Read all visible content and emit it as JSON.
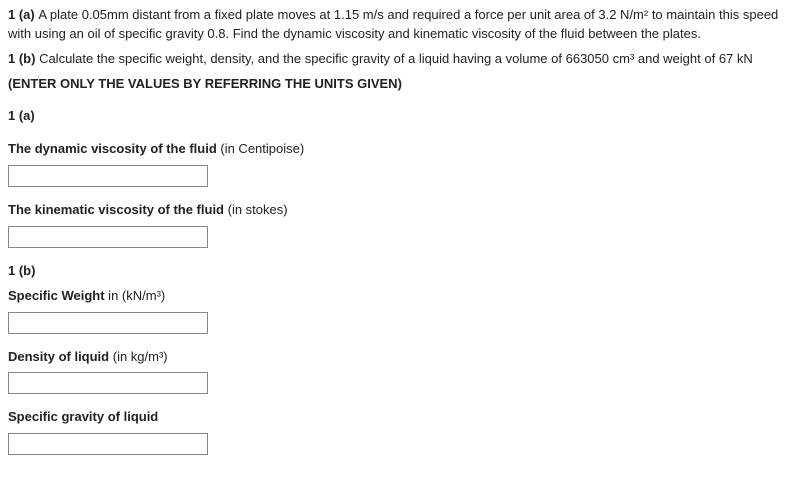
{
  "problem_1a_prefix": "1 (a) ",
  "problem_1a_text": "A plate 0.05mm distant from a fixed plate moves at 1.15 m/s and required a force per unit area of 3.2 N/m² to maintain this speed with using an oil of specific gravity 0.8. Find the dynamic viscosity and kinematic viscosity of the fluid between the plates.",
  "problem_1b_prefix": "1 (b)  ",
  "problem_1b_text": "Calculate the specific weight, density, and the specific gravity of a liquid having a volume of 663050 cm³ and weight of 67 kN",
  "instruction": "(ENTER ONLY THE VALUES BY REFERRING THE UNITS GIVEN)",
  "section_1a": "1 (a)",
  "section_1b": "1 (b)",
  "fields": {
    "dyn_visc_label": "The dynamic viscosity of the fluid",
    "dyn_visc_unit": " (in Centipoise)",
    "kin_visc_label": "The kinematic viscosity of the fluid",
    "kin_visc_unit": " (in stokes)",
    "spec_weight_label": "Specific Weight",
    "spec_weight_unit": " in (kN/m³)",
    "density_label": "Density of liquid",
    "density_unit": " (in kg/m³)",
    "spec_gravity_label": "Specific gravity of liquid"
  }
}
